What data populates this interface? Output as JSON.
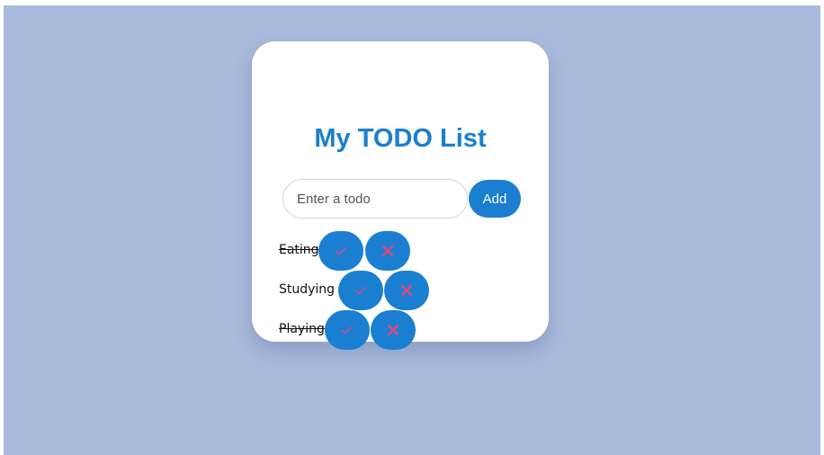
{
  "card": {
    "title": "My TODO List"
  },
  "form": {
    "input_placeholder": "Enter a todo",
    "input_value": "",
    "add_label": "Add"
  },
  "todos": [
    {
      "text": "Eating",
      "done": true
    },
    {
      "text": "Studying",
      "done": false
    },
    {
      "text": "Playing",
      "done": true
    }
  ],
  "icons": {
    "done": "check-icon",
    "delete": "close-icon"
  },
  "colors": {
    "background": "#a9bbdd",
    "card": "#ffffff",
    "accent": "#1a7fd0",
    "icon": "#e0457b"
  }
}
